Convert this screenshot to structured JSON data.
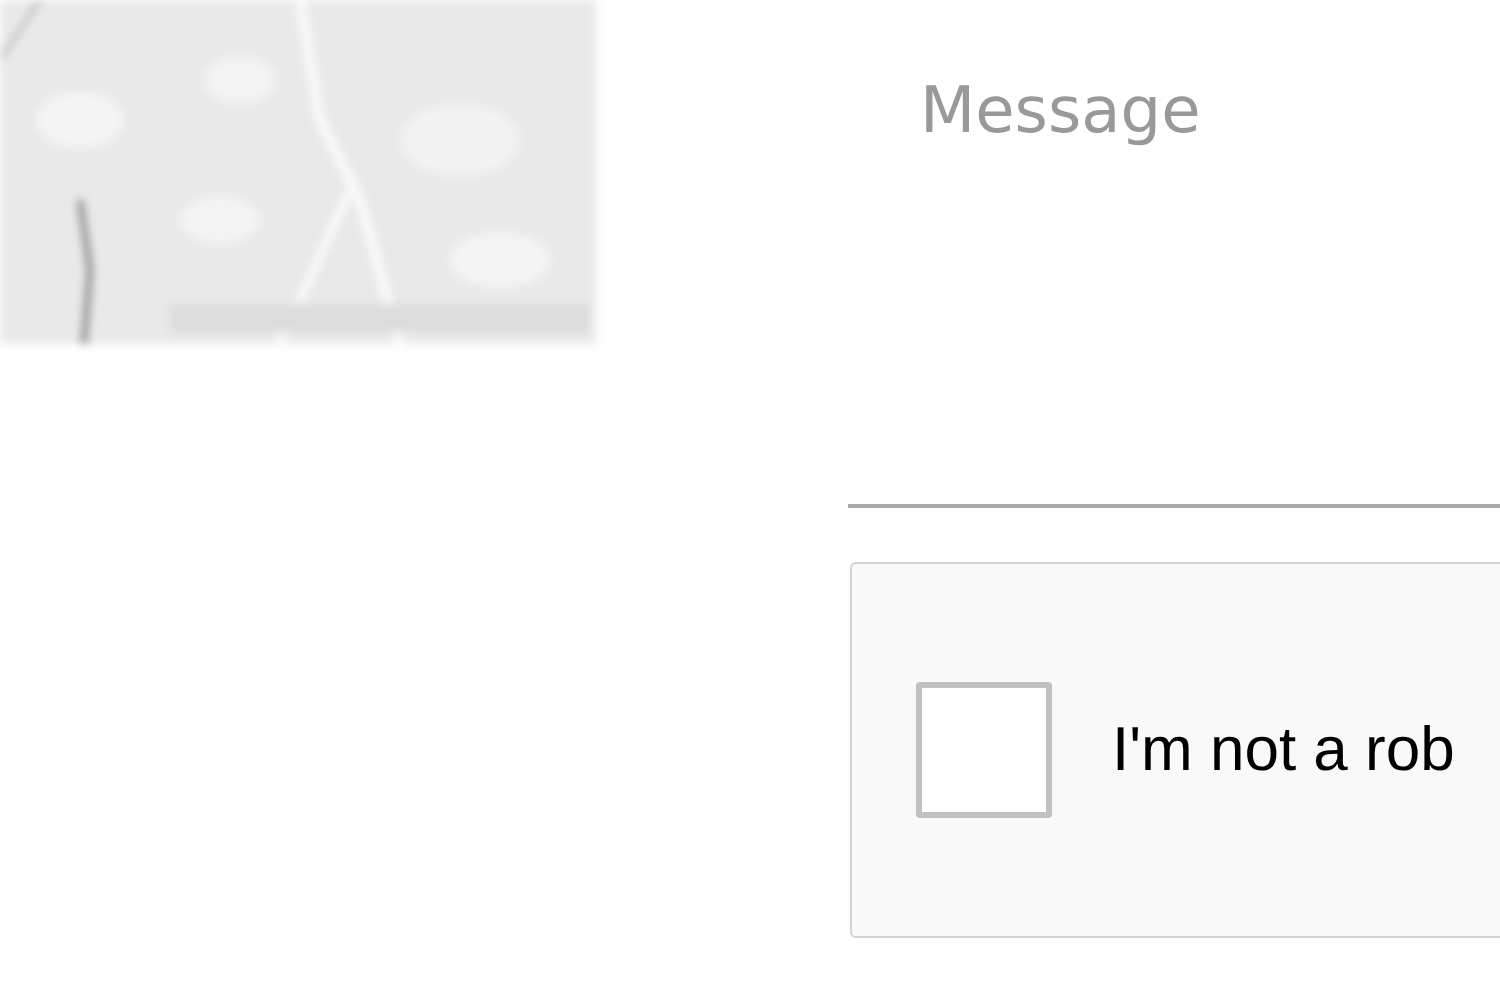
{
  "message_field": {
    "placeholder": "Message"
  },
  "captcha": {
    "checked": false,
    "label": "I'm not a rob"
  }
}
